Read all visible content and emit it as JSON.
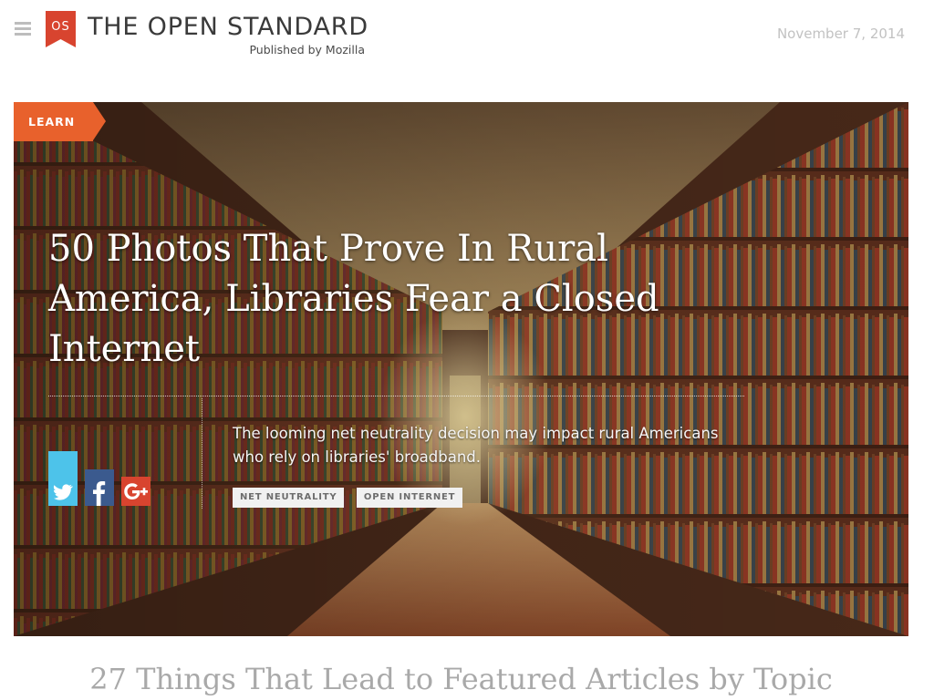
{
  "header": {
    "logo_letters": "OS",
    "site_title": "THE OPEN STANDARD",
    "site_subtitle": "Published by Mozilla",
    "date": "November 7, 2014",
    "colors": {
      "logo_red": "#d8442f",
      "date_gray": "#c2c2c2"
    }
  },
  "hero": {
    "category": "LEARN",
    "title": "50 Photos That Prove In Rural America, Libraries Fear a Closed Internet",
    "dek": "The looming net neutrality decision may impact rural Americans who rely on libraries' broadband.",
    "tags": [
      "NET NEUTRALITY",
      "OPEN INTERNET"
    ],
    "colors": {
      "category_orange": "#e8612c"
    }
  },
  "share": {
    "icons": [
      "twitter-icon",
      "facebook-icon",
      "google-plus-icon"
    ],
    "colors": {
      "twitter": "#4dc3ea",
      "facebook": "#3b5a8e",
      "google_plus": "#d8442f"
    }
  },
  "section": {
    "heading": "27 Things That Lead to Featured Articles by Topic"
  }
}
